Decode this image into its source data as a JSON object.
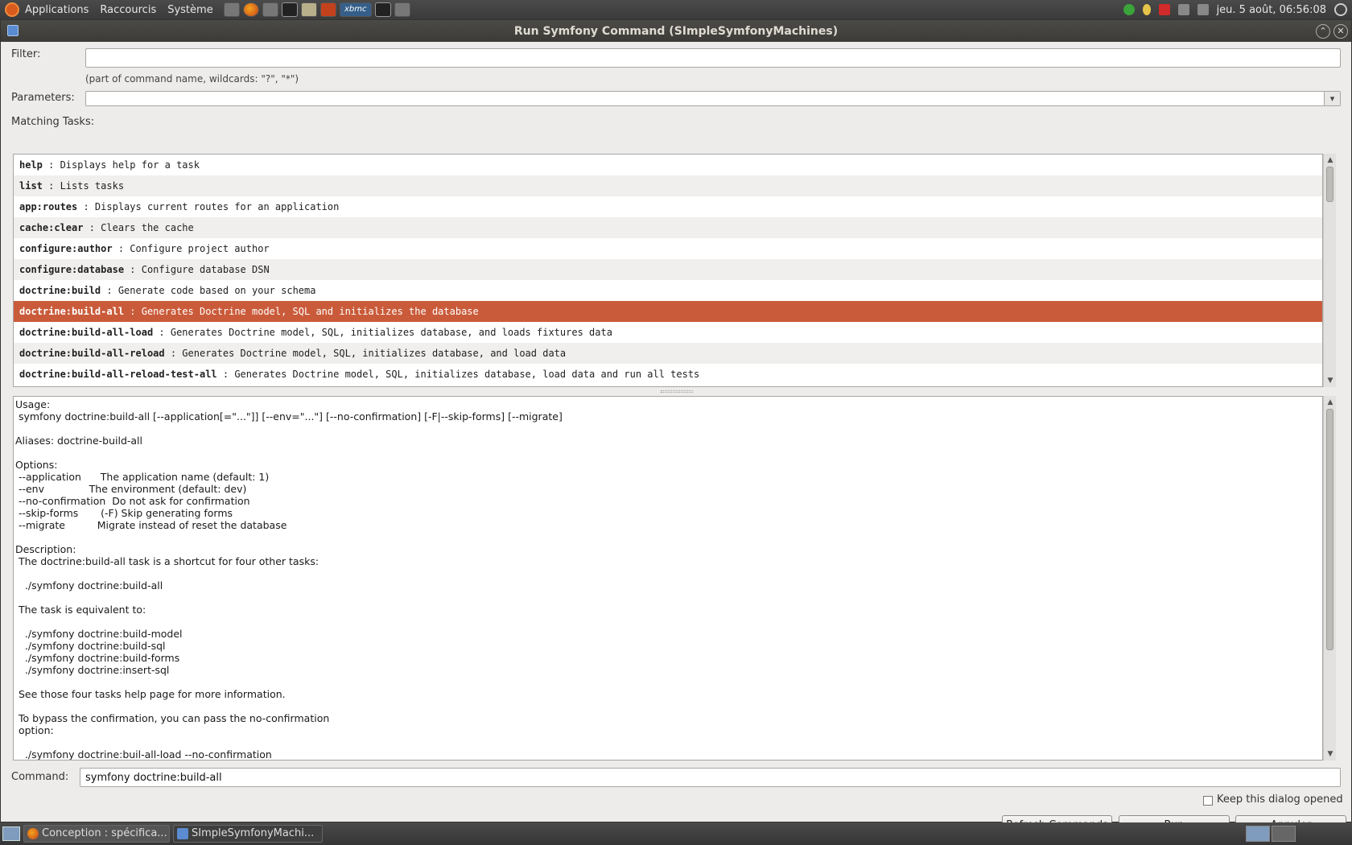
{
  "top_panel": {
    "menus": [
      "Applications",
      "Raccourcis",
      "Système"
    ],
    "xbmc_label": "xbmc",
    "clock": "jeu. 5 août, 06:56:08"
  },
  "window": {
    "title": "Run Symfony Command (SImpleSymfonyMachines)",
    "filter_label": "Filter:",
    "filter_value": "",
    "filter_hint": "(part of command name, wildcards: \"?\", \"*\")",
    "parameters_label": "Parameters:",
    "parameters_value": "",
    "matching_label": "Matching Tasks:",
    "tasks": [
      {
        "cmd": "help",
        "desc": " : Displays help for a task"
      },
      {
        "cmd": "list",
        "desc": " : Lists tasks"
      },
      {
        "cmd": "app:routes",
        "desc": " : Displays current routes for an application"
      },
      {
        "cmd": "cache:clear",
        "desc": " : Clears the cache"
      },
      {
        "cmd": "configure:author",
        "desc": " : Configure project author"
      },
      {
        "cmd": "configure:database",
        "desc": " : Configure database DSN"
      },
      {
        "cmd": "doctrine:build",
        "desc": " : Generate code based on your schema"
      },
      {
        "cmd": "doctrine:build-all",
        "desc": " : Generates Doctrine model, SQL and initializes the database"
      },
      {
        "cmd": "doctrine:build-all-load",
        "desc": " : Generates Doctrine model, SQL, initializes database, and loads fixtures data"
      },
      {
        "cmd": "doctrine:build-all-reload",
        "desc": " : Generates Doctrine model, SQL, initializes database, and load data"
      },
      {
        "cmd": "doctrine:build-all-reload-test-all",
        "desc": " : Generates Doctrine model, SQL, initializes database, load data and run all tests"
      }
    ],
    "selected_task_index": 7,
    "description_lines": [
      "Usage:",
      " symfony doctrine:build-all [--application[=\"...\"]] [--env=\"...\"] [--no-confirmation] [-F|--skip-forms] [--migrate]",
      "",
      "Aliases: doctrine-build-all",
      "",
      "Options:",
      " --application      The application name (default: 1)",
      " --env              The environment (default: dev)",
      " --no-confirmation  Do not ask for confirmation",
      " --skip-forms       (-F) Skip generating forms",
      " --migrate          Migrate instead of reset the database",
      "",
      "Description:",
      " The doctrine:build-all task is a shortcut for four other tasks:",
      "",
      "   ./symfony doctrine:build-all",
      "",
      " The task is equivalent to:",
      "",
      "   ./symfony doctrine:build-model",
      "   ./symfony doctrine:build-sql",
      "   ./symfony doctrine:build-forms",
      "   ./symfony doctrine:insert-sql",
      "",
      " See those four tasks help page for more information.",
      "",
      " To bypass the confirmation, you can pass the no-confirmation",
      " option:",
      "",
      "   ./symfony doctrine:buil-all-load --no-confirmation"
    ],
    "command_label": "Command:",
    "command_value": "symfony doctrine:build-all",
    "keep_open_label": "Keep this dialog opened",
    "keep_open_checked": false,
    "refresh_label": "Refresh Commands",
    "run_label": "Run",
    "cancel_label": "Annuler"
  },
  "taskbar": {
    "items": [
      {
        "label": "Conception : spécifica...",
        "icon": "firefox-icon",
        "active": false
      },
      {
        "label": "SImpleSymfonyMachi...",
        "icon": "netbeans-icon",
        "active": true
      }
    ]
  }
}
